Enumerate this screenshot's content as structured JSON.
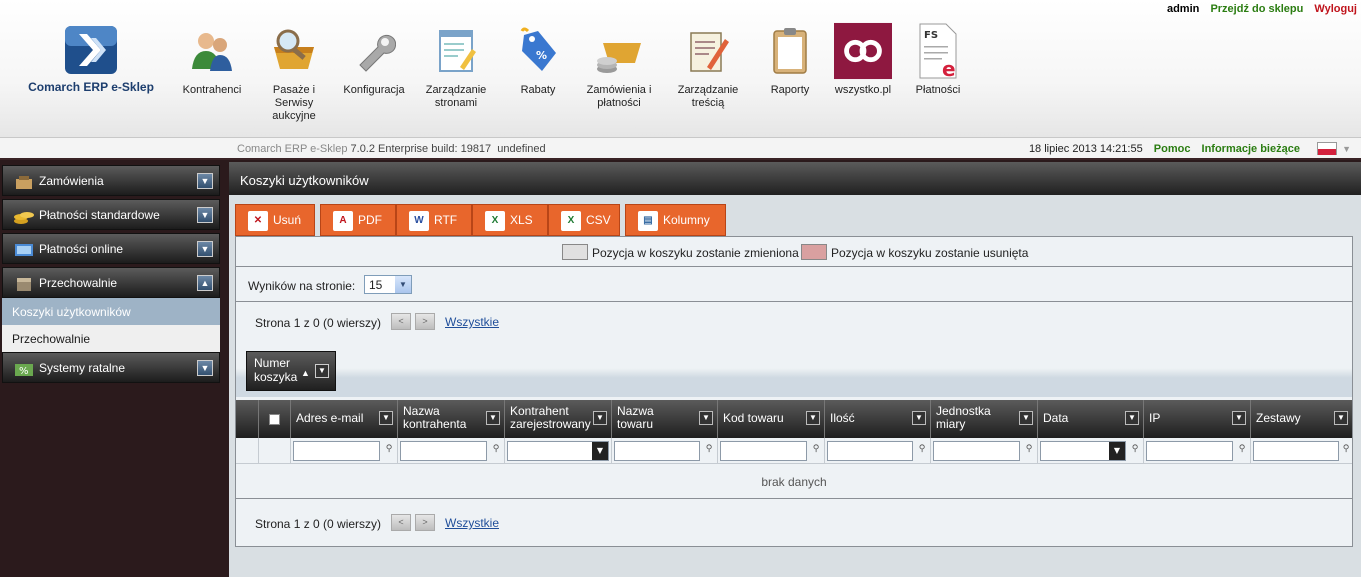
{
  "top_links": {
    "user": "admin",
    "shop": "Przejdź do sklepu",
    "logout": "Wyloguj"
  },
  "brand": {
    "name": "Comarch ERP e-Sklep"
  },
  "nav": [
    {
      "label": "Kontrahenci",
      "icon": "users-icon"
    },
    {
      "label": "Pasaże i Serwisy aukcyjne",
      "icon": "basket-magnifier-icon"
    },
    {
      "label": "Konfiguracja",
      "icon": "wrench-icon"
    },
    {
      "label": "Zarządzanie stronami",
      "icon": "page-edit-icon"
    },
    {
      "label": "Rabaty",
      "icon": "discount-tag-icon"
    },
    {
      "label": "Zamówienia i płatności",
      "icon": "basket-coins-icon"
    },
    {
      "label": "Zarządzanie treścią",
      "icon": "notebook-pencil-icon"
    },
    {
      "label": "Raporty",
      "icon": "clipboard-icon"
    },
    {
      "label": "wszystko.pl",
      "icon": "wszystko-logo-icon"
    },
    {
      "label": "Płatności",
      "icon": "invoice-fs-icon"
    }
  ],
  "subheader": {
    "build_prefix": "Comarch ERP e-Sklep",
    "build_version": "7.0.2 Enterprise build: 19817",
    "build_suffix": "undefined",
    "datetime": "18 lipiec 2013 14:21:55",
    "help": "Pomoc",
    "info": "Informacje bieżące"
  },
  "sidebar": {
    "sections": [
      {
        "label": "Zamówienia",
        "toggle": "▼"
      },
      {
        "label": "Płatności standardowe",
        "toggle": "▼"
      },
      {
        "label": "Płatności online",
        "toggle": "▼"
      },
      {
        "label": "Przechowalnie",
        "toggle": "▲"
      }
    ],
    "sub_items": [
      {
        "label": "Koszyki użytkowników",
        "active": true
      },
      {
        "label": "Przechowalnie",
        "active": false
      }
    ],
    "last_section": {
      "label": "Systemy ratalne",
      "toggle": "▼"
    }
  },
  "panel": {
    "title": "Koszyki użytkowników",
    "toolbar": [
      {
        "label": "Usuń",
        "icon": "delete-icon",
        "glyph": "✕",
        "color": "#c0151d"
      },
      {
        "label": "PDF",
        "icon": "pdf-icon",
        "glyph": "A",
        "color": "#c0151d"
      },
      {
        "label": "RTF",
        "icon": "word-icon",
        "glyph": "W",
        "color": "#2a4fa0"
      },
      {
        "label": "XLS",
        "icon": "excel-icon",
        "glyph": "X",
        "color": "#1e7a32"
      },
      {
        "label": "CSV",
        "icon": "csv-icon",
        "glyph": "X",
        "color": "#1e7a32"
      },
      {
        "label": "Kolumny",
        "icon": "columns-icon",
        "glyph": "▤",
        "color": "#3a6ea5"
      }
    ],
    "legend": {
      "changed": "Pozycja w koszyku zostanie zmieniona",
      "changed_color": "#e0e0e0",
      "removed": "Pozycja w koszyku zostanie usunięta",
      "removed_color": "#d9a0a0"
    },
    "per_page_label": "Wyników na stronie:",
    "per_page_value": "15",
    "pager": {
      "text": "Strona 1 z 0 (0 wierszy)",
      "prev": "<",
      "next": ">",
      "all": "Wszystkie"
    },
    "sort": {
      "line1": "Numer",
      "line2": "koszyka",
      "arrow": "▲",
      "dd": "▼"
    },
    "columns": [
      {
        "line1": "Adres e-mail",
        "line2": ""
      },
      {
        "line1": "Nazwa",
        "line2": "kontrahenta"
      },
      {
        "line1": "Kontrahent",
        "line2": "zarejestrowany"
      },
      {
        "line1": "Nazwa",
        "line2": "towaru"
      },
      {
        "line1": "Kod towaru",
        "line2": ""
      },
      {
        "line1": "Ilość",
        "line2": ""
      },
      {
        "line1": "Jednostka",
        "line2": "miary"
      },
      {
        "line1": "Data",
        "line2": ""
      },
      {
        "line1": "IP",
        "line2": ""
      },
      {
        "line1": "Zestawy",
        "line2": ""
      }
    ],
    "no_data": "brak danych"
  }
}
